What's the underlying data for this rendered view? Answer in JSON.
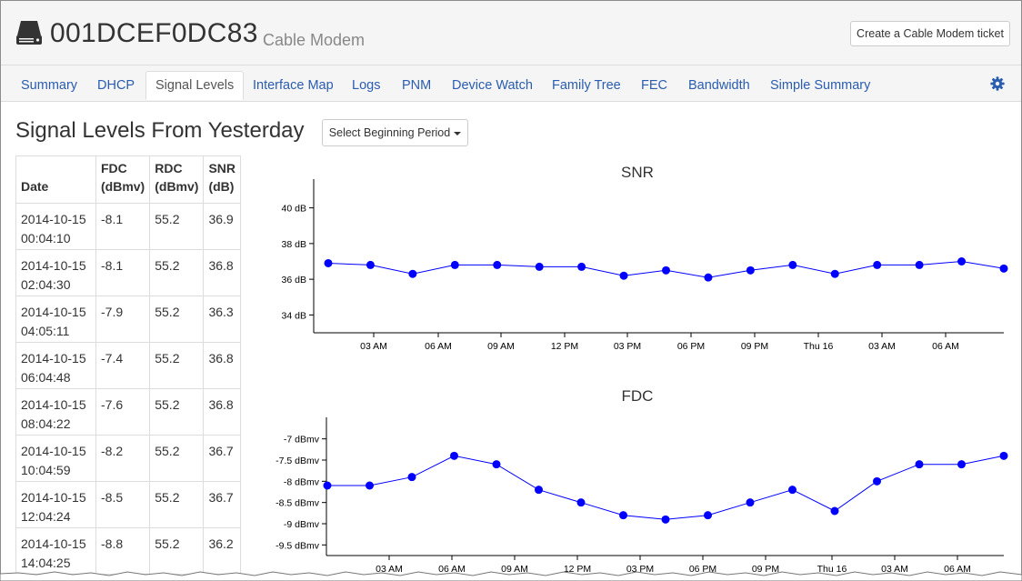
{
  "header": {
    "device_id": "001DCEF0DC83",
    "device_type": "Cable Modem",
    "ticket_button": "Create a Cable Modem ticket"
  },
  "tabs": [
    {
      "label": "Summary",
      "active": false
    },
    {
      "label": "DHCP",
      "active": false
    },
    {
      "label": "Signal Levels",
      "active": true
    },
    {
      "label": "Interface Map",
      "active": false
    },
    {
      "label": "Logs",
      "active": false
    },
    {
      "label": "PNM",
      "active": false
    },
    {
      "label": "Device Watch",
      "active": false
    },
    {
      "label": "Family Tree",
      "active": false
    },
    {
      "label": "FEC",
      "active": false
    },
    {
      "label": "Bandwidth",
      "active": false
    },
    {
      "label": "Simple Summary",
      "active": false
    }
  ],
  "main": {
    "title": "Signal Levels From Yesterday",
    "period_button": "Select Beginning Period"
  },
  "table": {
    "headers": {
      "date": "Date",
      "fdc_1": "FDC",
      "fdc_2": "(dBmv)",
      "rdc_1": "RDC",
      "rdc_2": "(dBmv)",
      "snr_1": "SNR",
      "snr_2": "(dB)"
    },
    "rows": [
      {
        "date": "2014-10-15",
        "time": "00:04:10",
        "fdc": "-8.1",
        "rdc": "55.2",
        "snr": "36.9"
      },
      {
        "date": "2014-10-15",
        "time": "02:04:30",
        "fdc": "-8.1",
        "rdc": "55.2",
        "snr": "36.8"
      },
      {
        "date": "2014-10-15",
        "time": "04:05:11",
        "fdc": "-7.9",
        "rdc": "55.2",
        "snr": "36.3"
      },
      {
        "date": "2014-10-15",
        "time": "06:04:48",
        "fdc": "-7.4",
        "rdc": "55.2",
        "snr": "36.8"
      },
      {
        "date": "2014-10-15",
        "time": "08:04:22",
        "fdc": "-7.6",
        "rdc": "55.2",
        "snr": "36.8"
      },
      {
        "date": "2014-10-15",
        "time": "10:04:59",
        "fdc": "-8.2",
        "rdc": "55.2",
        "snr": "36.7"
      },
      {
        "date": "2014-10-15",
        "time": "12:04:24",
        "fdc": "-8.5",
        "rdc": "55.2",
        "snr": "36.7"
      },
      {
        "date": "2014-10-15",
        "time": "14:04:25",
        "fdc": "-8.8",
        "rdc": "55.2",
        "snr": "36.2"
      }
    ]
  },
  "colors": {
    "accent": "#2a5db0",
    "series": "#0000ff"
  },
  "icons": {
    "device": "hard-drive-icon",
    "settings": "gear-icon",
    "dropdown": "caret-down-icon"
  },
  "chart_data": [
    {
      "type": "line",
      "title": "SNR",
      "x": [
        "2014-10-15 00:04",
        "2014-10-15 02:04",
        "2014-10-15 04:05",
        "2014-10-15 06:04",
        "2014-10-15 08:04",
        "2014-10-15 10:05",
        "2014-10-15 12:04",
        "2014-10-15 14:04",
        "2014-10-15 16:04",
        "2014-10-15 18:04",
        "2014-10-15 20:04",
        "2014-10-15 22:04",
        "2014-10-16 00:04",
        "2014-10-16 02:04",
        "2014-10-16 04:04",
        "2014-10-16 06:04",
        "2014-10-16 08:04"
      ],
      "x_ticks": [
        "03 AM",
        "06 AM",
        "09 AM",
        "12 PM",
        "03 PM",
        "06 PM",
        "09 PM",
        "Thu 16",
        "03 AM",
        "06 AM"
      ],
      "y_ticks": [
        "40 dB",
        "38 dB",
        "36 dB",
        "34 dB"
      ],
      "ylim": [
        33,
        41
      ],
      "values": [
        36.9,
        36.8,
        36.3,
        36.8,
        36.8,
        36.7,
        36.7,
        36.2,
        36.5,
        36.1,
        36.5,
        36.8,
        36.3,
        36.8,
        36.8,
        37.0,
        36.6
      ],
      "unit": "dB"
    },
    {
      "type": "line",
      "title": "FDC",
      "x": [
        "2014-10-15 00:04",
        "2014-10-15 02:04",
        "2014-10-15 04:05",
        "2014-10-15 06:04",
        "2014-10-15 08:04",
        "2014-10-15 10:05",
        "2014-10-15 12:04",
        "2014-10-15 14:04",
        "2014-10-15 16:04",
        "2014-10-15 18:04",
        "2014-10-15 20:04",
        "2014-10-15 22:04",
        "2014-10-16 00:04",
        "2014-10-16 02:04",
        "2014-10-16 04:04",
        "2014-10-16 06:04",
        "2014-10-16 08:04"
      ],
      "x_ticks": [
        "03 AM",
        "06 AM",
        "09 AM",
        "12 PM",
        "03 PM",
        "06 PM",
        "09 PM",
        "Thu 16",
        "03 AM",
        "06 AM"
      ],
      "y_ticks": [
        "-7 dBmv",
        "-7.5 dBmv",
        "-8 dBmv",
        "-8.5 dBmv",
        "-9 dBmv",
        "-9.5 dBmv"
      ],
      "ylim": [
        -9.75,
        -6.75
      ],
      "values": [
        -8.1,
        -8.1,
        -7.9,
        -7.4,
        -7.6,
        -8.2,
        -8.5,
        -8.8,
        -8.9,
        -8.8,
        -8.5,
        -8.2,
        -8.7,
        -8.0,
        -7.6,
        -7.6,
        -7.4
      ],
      "unit": "dBmv"
    }
  ]
}
